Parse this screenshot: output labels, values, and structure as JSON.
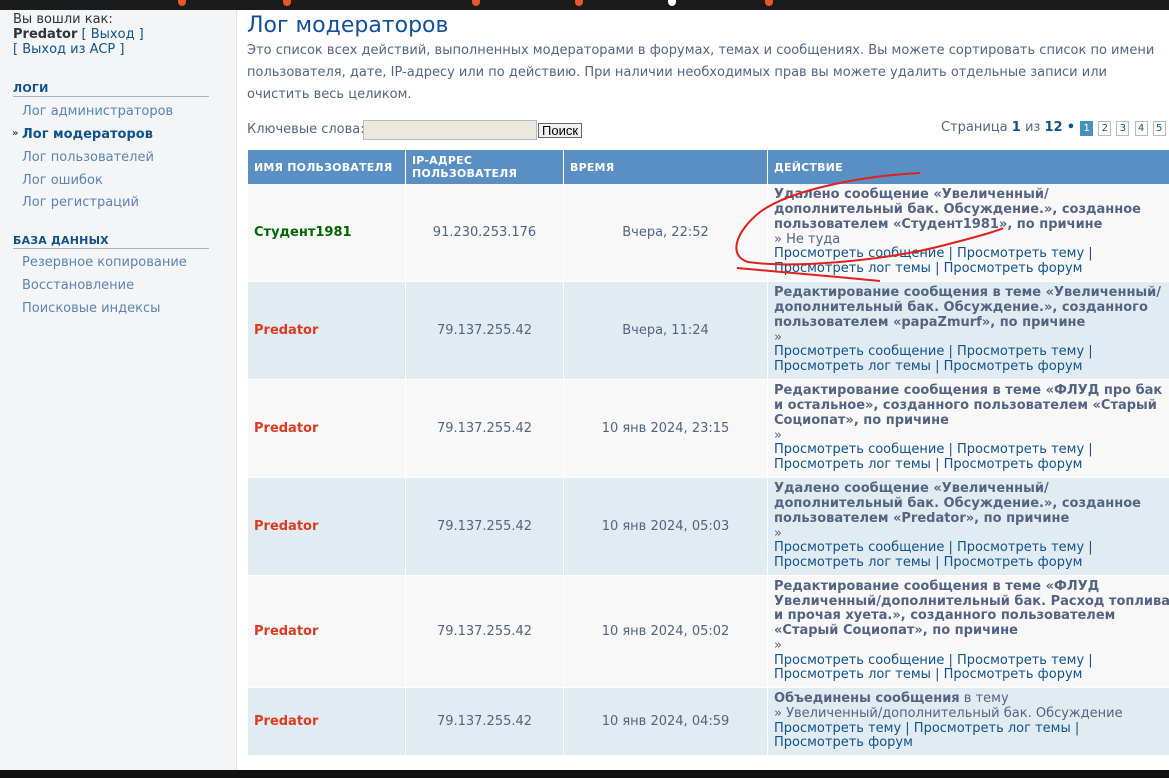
{
  "sidebar": {
    "logged_in_label": "Вы вошли как:",
    "username": "Predator",
    "logout_label": "[ Выход ]",
    "exit_acp_label": "[ Выход из ACP ]",
    "logs_section": "ЛОГИ",
    "logs_items": [
      "Лог администраторов",
      "Лог модераторов",
      "Лог пользователей",
      "Лог ошибок",
      "Лог регистраций"
    ],
    "active_marker": "»",
    "db_section": "БАЗА ДАННЫХ",
    "db_items": [
      "Резервное копирование",
      "Восстановление",
      "Поисковые индексы"
    ]
  },
  "main": {
    "title": "Лог модераторов",
    "description": "Это список всех действий, выполненных модераторами в форумах, темах и сообщениях. Вы можете сортировать список по имени пользователя, дате, IP-адресу или по действию. При наличии необходимых прав вы можете удалить отдельные записи или очистить весь целиком.",
    "keywords_label": "Ключевые слова:",
    "keywords_value": "",
    "search_button": "Поиск",
    "pagination": {
      "prefix": "Страница",
      "current": "1",
      "of": "из",
      "total": "12",
      "bullet": "•",
      "pages": [
        "1",
        "2",
        "3",
        "4",
        "5"
      ],
      "ellipsis": "..."
    }
  },
  "table": {
    "headers": [
      "ИМЯ ПОЛЬЗОВАТЕЛЯ",
      "IP-АДРЕС ПОЛЬЗОВАТЕЛЯ",
      "ВРЕМЯ",
      "ДЕЙСТВИЕ"
    ],
    "rows": [
      {
        "user": "Студент1981",
        "ip": "91.230.253.176",
        "time": "Вчера, 22:52",
        "action_title": "Удалено сообщение «Увеличенный/дополнительный бак. Обсуждение.», созданное пользователем «Студент1981», по причине",
        "action_detail": "» Не туда",
        "action_links": "Просмотреть сообщение | Просмотреть тему | Просмотреть лог темы | Просмотреть форум"
      },
      {
        "user": "Predator",
        "ip": "79.137.255.42",
        "time": "Вчера, 11:24",
        "action_title": "Редактирование сообщения в теме «Увеличенный/дополнительный бак. Обсуждение.», созданного пользователем «papaZmurf», по причине",
        "action_detail": "»",
        "action_links": "Просмотреть сообщение | Просмотреть тему | Просмотреть лог темы | Просмотреть форум"
      },
      {
        "user": "Predator",
        "ip": "79.137.255.42",
        "time": "10 янв 2024, 23:15",
        "action_title": "Редактирование сообщения в теме «ФЛУД про бак и остальное», созданного пользователем «Старый Социопат», по причине",
        "action_detail": "»",
        "action_links": "Просмотреть сообщение | Просмотреть тему | Просмотреть лог темы | Просмотреть форум"
      },
      {
        "user": "Predator",
        "ip": "79.137.255.42",
        "time": "10 янв 2024, 05:03",
        "action_title": "Удалено сообщение «Увеличенный/дополнительный бак. Обсуждение.», созданное пользователем «Predator», по причине",
        "action_detail": "»",
        "action_links": "Просмотреть сообщение | Просмотреть тему | Просмотреть лог темы | Просмотреть форум"
      },
      {
        "user": "Predator",
        "ip": "79.137.255.42",
        "time": "10 янв 2024, 05:02",
        "action_title": "Редактирование сообщения в теме «ФЛУД Увеличенный/дополнительный бак. Расход топлива и прочая хуета.», созданного пользователем «Старый Социопат», по причине",
        "action_detail": "»",
        "action_links": "Просмотреть сообщение | Просмотреть тему | Просмотреть лог темы | Просмотреть форум"
      },
      {
        "user": "Predator",
        "ip": "79.137.255.42",
        "time": "10 янв 2024, 04:59",
        "action_title": "Объединены сообщения",
        "action_title_suffix": " в тему",
        "action_detail": "» Увеличенный/дополнительный бак. Обсуждение",
        "action_links": "Просмотреть тему | Просмотреть лог темы | Просмотреть форум"
      }
    ]
  },
  "colors": {
    "header_bg": "#5a8fc4",
    "link": "#105289",
    "user_green": "#006400",
    "user_red": "#dd3a1f",
    "annotation": "#e0201c"
  }
}
